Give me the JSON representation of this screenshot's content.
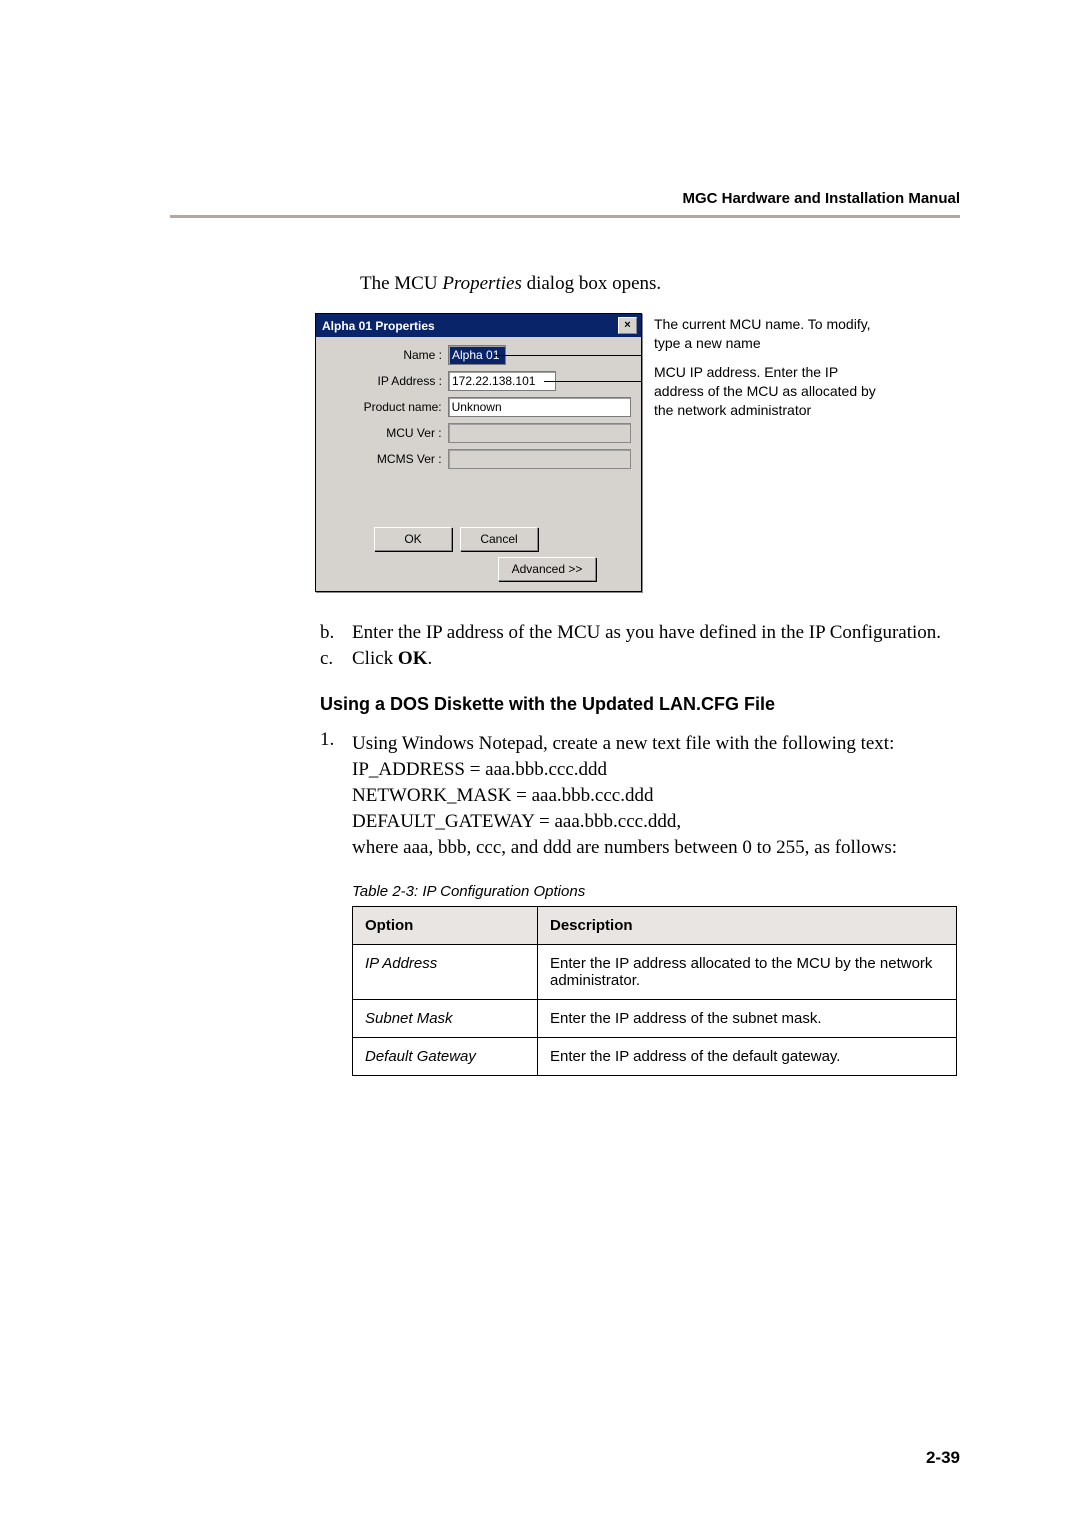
{
  "header": "MGC Hardware and Installation Manual",
  "intro_pre": "The MCU ",
  "intro_em": "Properties",
  "intro_post": " dialog box opens.",
  "dialog": {
    "title": "Alpha 01  Properties",
    "close": "×",
    "labels": {
      "name": "Name :",
      "ip": "IP Address :",
      "product": "Product name:",
      "mcu_ver": "MCU Ver :",
      "mcms_ver": "MCMS Ver :"
    },
    "values": {
      "name": "Alpha 01",
      "ip": "172.22.138.101",
      "product": "Unknown",
      "mcu_ver": "",
      "mcms_ver": ""
    },
    "buttons": {
      "ok": "OK",
      "cancel": "Cancel",
      "advanced": "Advanced >>"
    }
  },
  "annotations": {
    "name": "The current MCU name. To modify, type a new name",
    "ip": "MCU IP address. Enter the IP address of the MCU as allocated by the network administrator"
  },
  "steps": {
    "b": {
      "marker": "b.",
      "text": "Enter the IP address of the MCU as you have defined in the IP Configuration."
    },
    "c": {
      "marker": "c.",
      "pre": "Click ",
      "bold": "OK",
      "post": "."
    }
  },
  "heading2": "Using a DOS Diskette with the Updated LAN.CFG File",
  "num": {
    "marker": "1.",
    "lines": [
      "Using Windows Notepad, create a new text file with the following text:",
      "IP_ADDRESS = aaa.bbb.ccc.ddd",
      "NETWORK_MASK = aaa.bbb.ccc.ddd",
      "DEFAULT_GATEWAY = aaa.bbb.ccc.ddd,",
      "where aaa, bbb, ccc, and ddd are numbers between 0 to 255, as follows:"
    ]
  },
  "table": {
    "caption": "Table 2-3: IP Configuration Options",
    "headers": {
      "option": "Option",
      "desc": "Description"
    },
    "rows": [
      {
        "option": "IP Address",
        "desc": "Enter the IP address allocated to the MCU by the network administrator."
      },
      {
        "option": "Subnet Mask",
        "desc": "Enter the IP address of the subnet mask."
      },
      {
        "option": "Default Gateway",
        "desc": "Enter the IP address of the default gateway."
      }
    ]
  },
  "page_number": "2-39"
}
